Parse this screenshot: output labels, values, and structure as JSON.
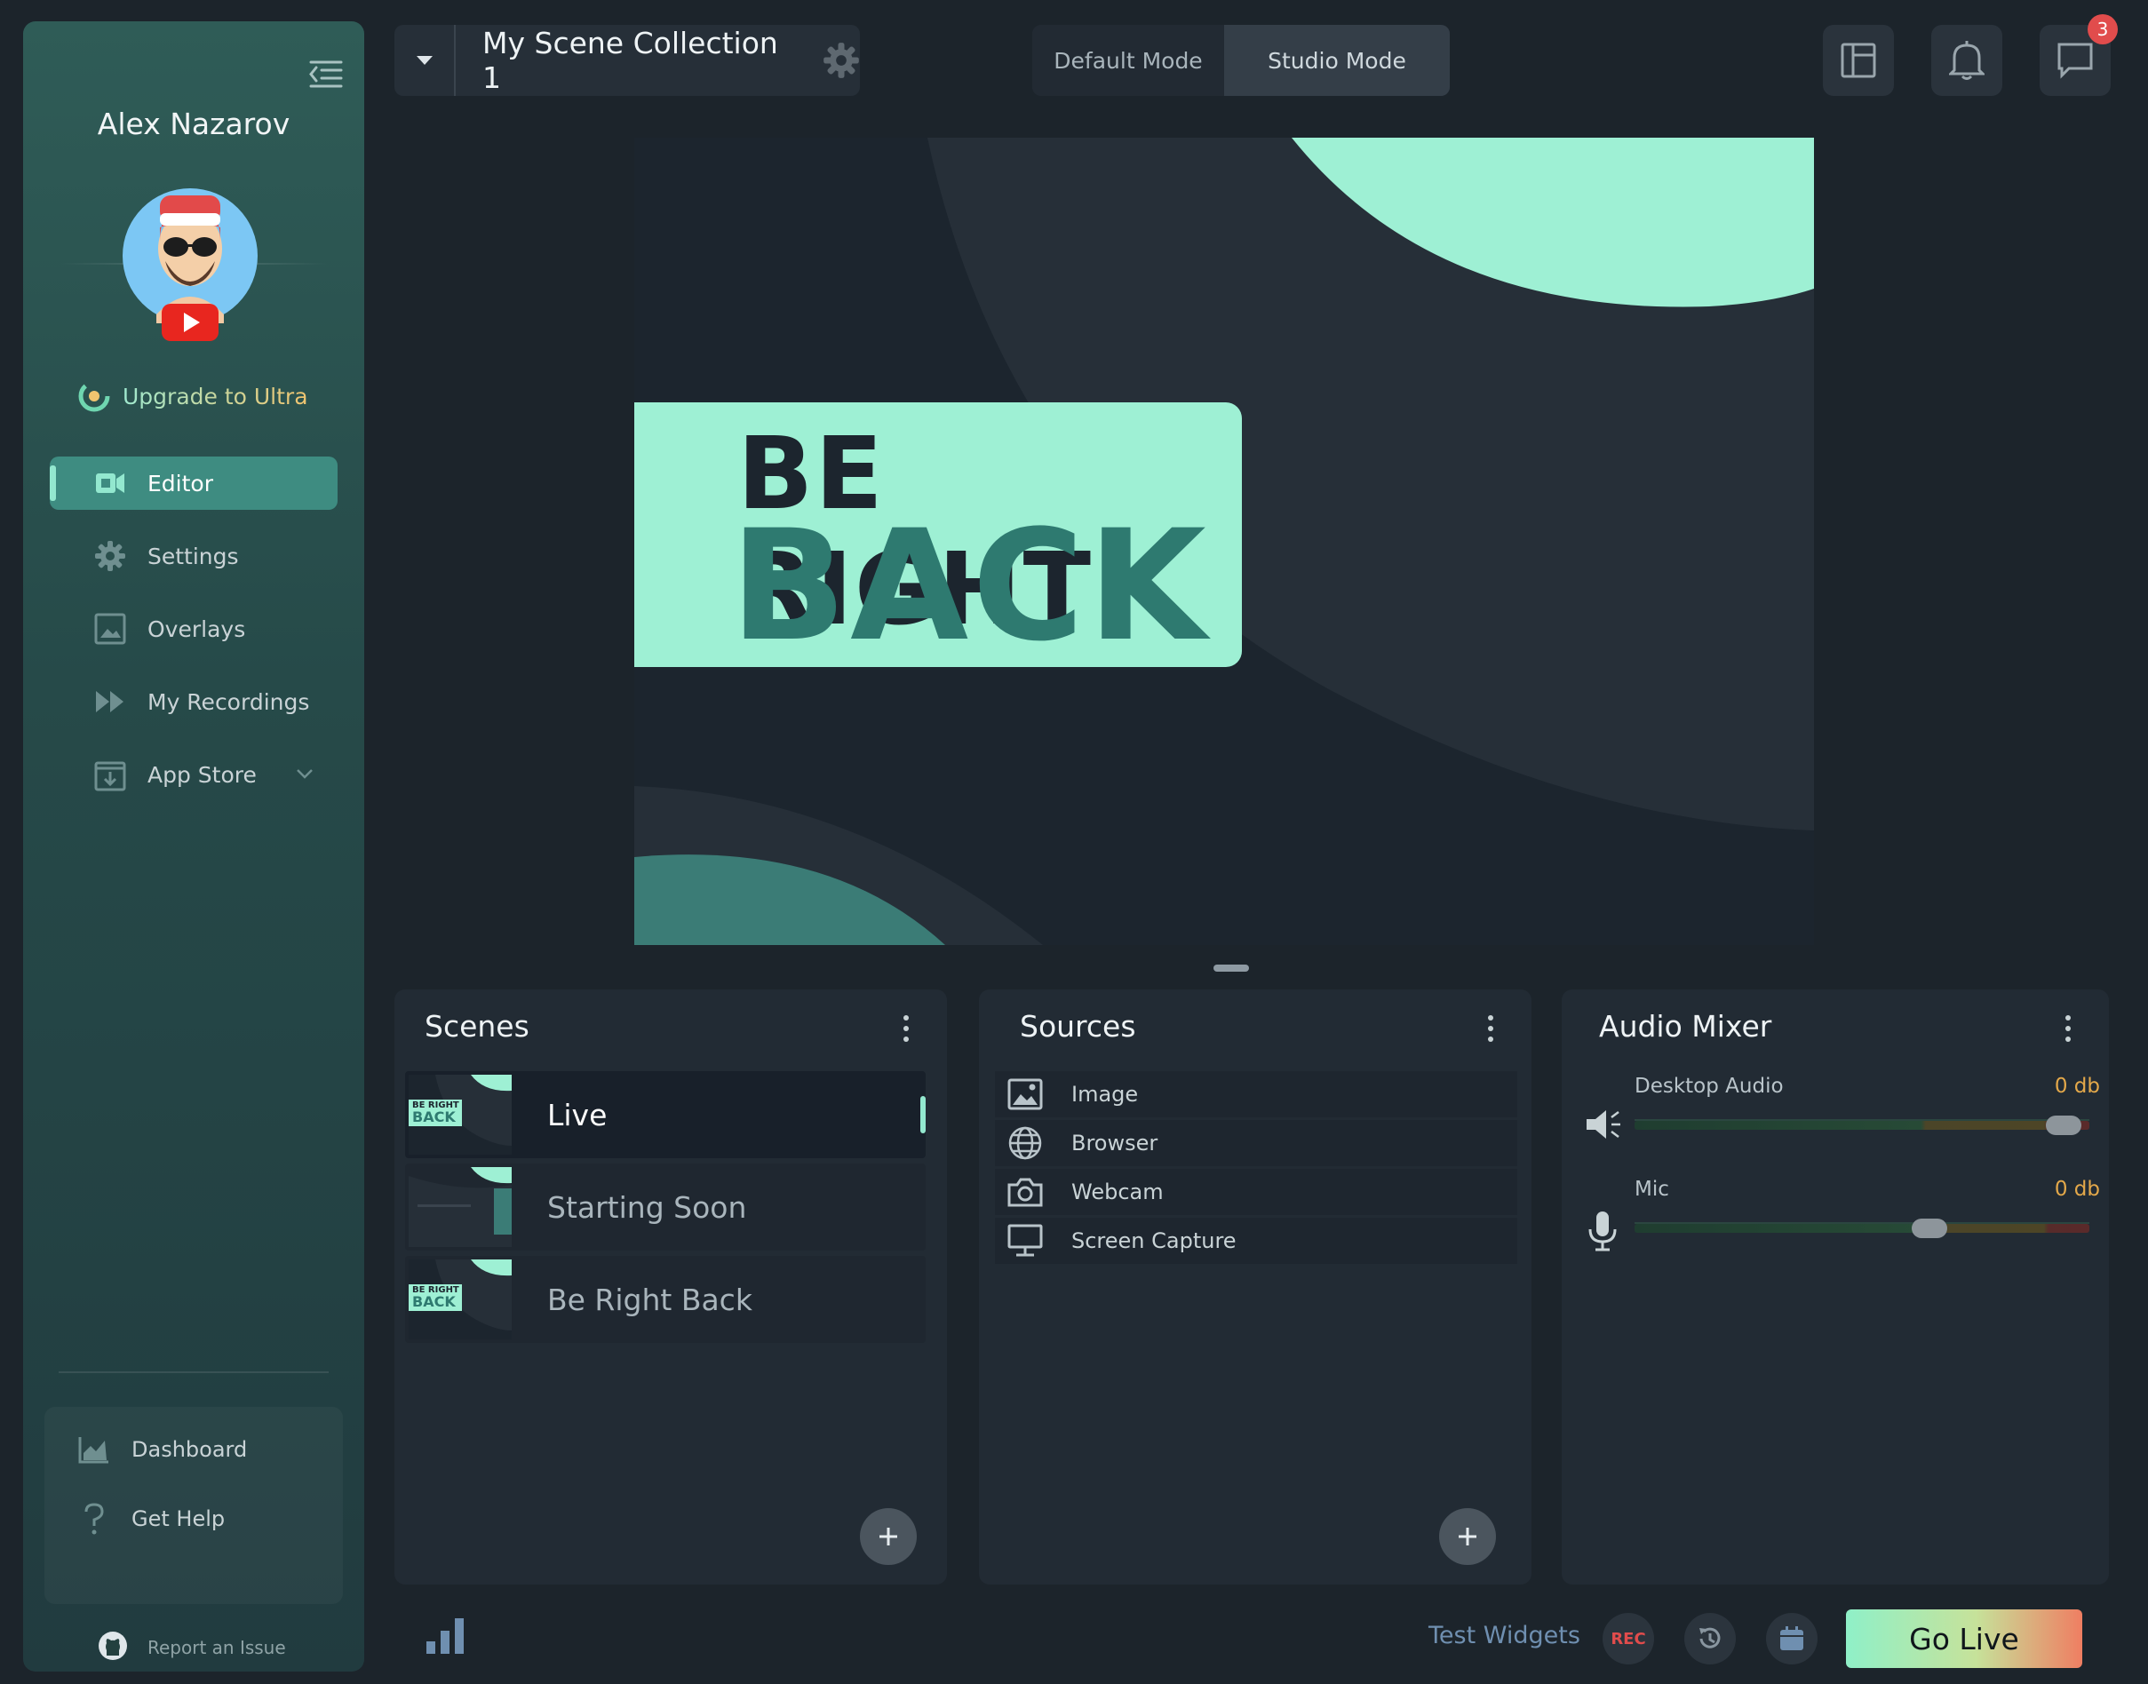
{
  "sidebar": {
    "user_name": "Alex Nazarov",
    "upgrade_label": "Upgrade to Ultra",
    "nav": [
      {
        "label": "Editor",
        "icon": "video-camera-icon",
        "active": true
      },
      {
        "label": "Settings",
        "icon": "gear-icon"
      },
      {
        "label": "Overlays",
        "icon": "image-icon"
      },
      {
        "label": "My Recordings",
        "icon": "fast-forward-icon"
      },
      {
        "label": "App Store",
        "icon": "download-box-icon"
      }
    ],
    "bottom": [
      {
        "label": "Dashboard",
        "icon": "area-chart-icon"
      },
      {
        "label": "Get Help",
        "icon": "question-icon"
      }
    ],
    "report_label": "Report an Issue"
  },
  "topbar": {
    "scene_collection": "My Scene Collection 1",
    "modes": [
      "Default Mode",
      "Studio Mode"
    ],
    "notification_badge": "3"
  },
  "preview": {
    "line1": "BE RIGHT",
    "line2": "BACK"
  },
  "scenes": {
    "title": "Scenes",
    "items": [
      {
        "label": "Live",
        "active": true
      },
      {
        "label": "Starting Soon"
      },
      {
        "label": "Be Right Back"
      }
    ],
    "thumb_text_1": "BE RIGHT",
    "thumb_text_2": "BACK"
  },
  "sources": {
    "title": "Sources",
    "items": [
      {
        "label": "Image",
        "icon": "image-icon"
      },
      {
        "label": "Browser",
        "icon": "globe-icon"
      },
      {
        "label": "Webcam",
        "icon": "camera-icon"
      },
      {
        "label": "Screen Capture",
        "icon": "monitor-icon"
      }
    ]
  },
  "mixer": {
    "title": "Audio Mixer",
    "channels": [
      {
        "name": "Desktop Audio",
        "db": "0 db",
        "level": 0.98
      },
      {
        "name": "Mic",
        "db": "0 db",
        "level": 0.66
      }
    ]
  },
  "bottombar": {
    "test_widgets": "Test Widgets",
    "rec": "REC",
    "go_live": "Go Live"
  },
  "colors": {
    "accent": "#93e8cf",
    "brand_teal": "#3e8c81",
    "alert_red": "#e14c4c",
    "db_orange": "#e3a84a"
  }
}
